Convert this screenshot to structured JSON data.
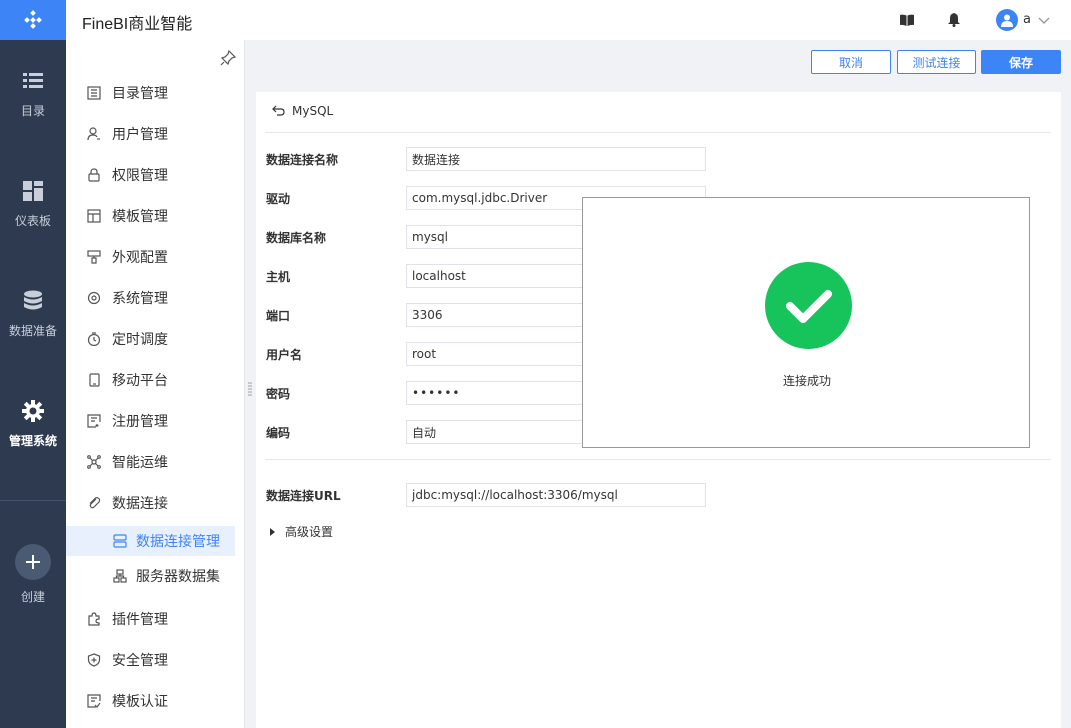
{
  "app": {
    "title": "FineBI商业智能"
  },
  "rail": {
    "items": [
      {
        "label": "目录",
        "icon": "list-icon"
      },
      {
        "label": "仪表板",
        "icon": "dashboard-icon"
      },
      {
        "label": "数据准备",
        "icon": "database-icon"
      },
      {
        "label": "管理系统",
        "icon": "gear-icon"
      },
      {
        "label": "创建",
        "icon": "plus-icon"
      }
    ]
  },
  "header": {
    "user_name": "a",
    "icons": [
      "book-icon",
      "bell-icon",
      "user-icon",
      "chevron-down-icon"
    ]
  },
  "sidebar": {
    "items": [
      {
        "label": "目录管理",
        "icon": "catalog-icon"
      },
      {
        "label": "用户管理",
        "icon": "user-manage-icon"
      },
      {
        "label": "权限管理",
        "icon": "lock-icon"
      },
      {
        "label": "模板管理",
        "icon": "template-icon"
      },
      {
        "label": "外观配置",
        "icon": "brush-icon"
      },
      {
        "label": "系统管理",
        "icon": "settings-icon"
      },
      {
        "label": "定时调度",
        "icon": "timer-icon"
      },
      {
        "label": "移动平台",
        "icon": "mobile-icon"
      },
      {
        "label": "注册管理",
        "icon": "register-icon"
      },
      {
        "label": "智能运维",
        "icon": "network-icon"
      },
      {
        "label": "数据连接",
        "icon": "link-icon"
      },
      {
        "label": "插件管理",
        "icon": "puzzle-icon"
      },
      {
        "label": "安全管理",
        "icon": "shield-icon"
      },
      {
        "label": "模板认证",
        "icon": "certify-icon"
      }
    ],
    "sub_items": [
      {
        "label": "数据连接管理",
        "icon": "db-connection-icon",
        "active": true
      },
      {
        "label": "服务器数据集",
        "icon": "server-dataset-icon",
        "active": false
      }
    ]
  },
  "toolbar": {
    "cancel_label": "取消",
    "test_label": "测试连接",
    "save_label": "保存"
  },
  "form": {
    "back_label": "MySQL",
    "fields": [
      {
        "label": "数据连接名称",
        "value": "数据连接"
      },
      {
        "label": "驱动",
        "value": "com.mysql.jdbc.Driver"
      },
      {
        "label": "数据库名称",
        "value": "mysql"
      },
      {
        "label": "主机",
        "value": "localhost"
      },
      {
        "label": "端口",
        "value": "3306"
      },
      {
        "label": "用户名",
        "value": "root"
      },
      {
        "label": "密码",
        "value": "••••••"
      },
      {
        "label": "编码",
        "value": "自动"
      }
    ],
    "url_label": "数据连接URL",
    "url_value": "jdbc:mysql://localhost:3306/mysql",
    "advanced_label": "高级设置"
  },
  "dialog": {
    "message": "连接成功",
    "success_color": "#17c45c"
  },
  "colors": {
    "accent": "#3d84f7",
    "rail_bg": "#2d3a4f"
  }
}
